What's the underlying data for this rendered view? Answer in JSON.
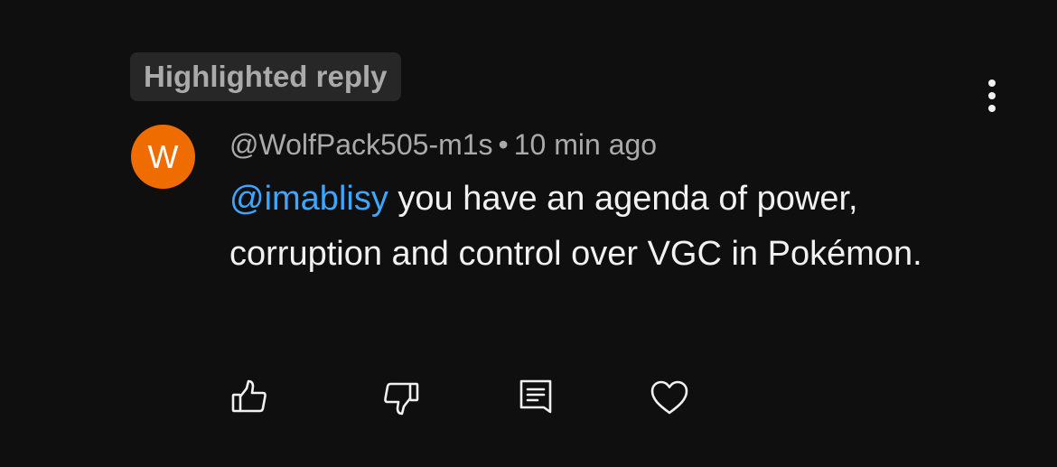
{
  "badge": {
    "label": "Highlighted reply"
  },
  "comment": {
    "avatar_letter": "W",
    "avatar_color": "#ef6c00",
    "author": "@WolfPack505-m1s",
    "separator": "•",
    "time": "10 min ago",
    "mention": "@imablisy",
    "text": " you have an agenda of power, corruption and control over VGC in Pokémon.",
    "mention_color": "#3ea6ff"
  },
  "menu": {
    "icon": "more-vert-icon"
  },
  "actions": [
    {
      "icon": "thumbs-up-icon"
    },
    {
      "icon": "thumbs-down-icon"
    },
    {
      "icon": "reply-icon"
    },
    {
      "icon": "heart-icon"
    }
  ]
}
